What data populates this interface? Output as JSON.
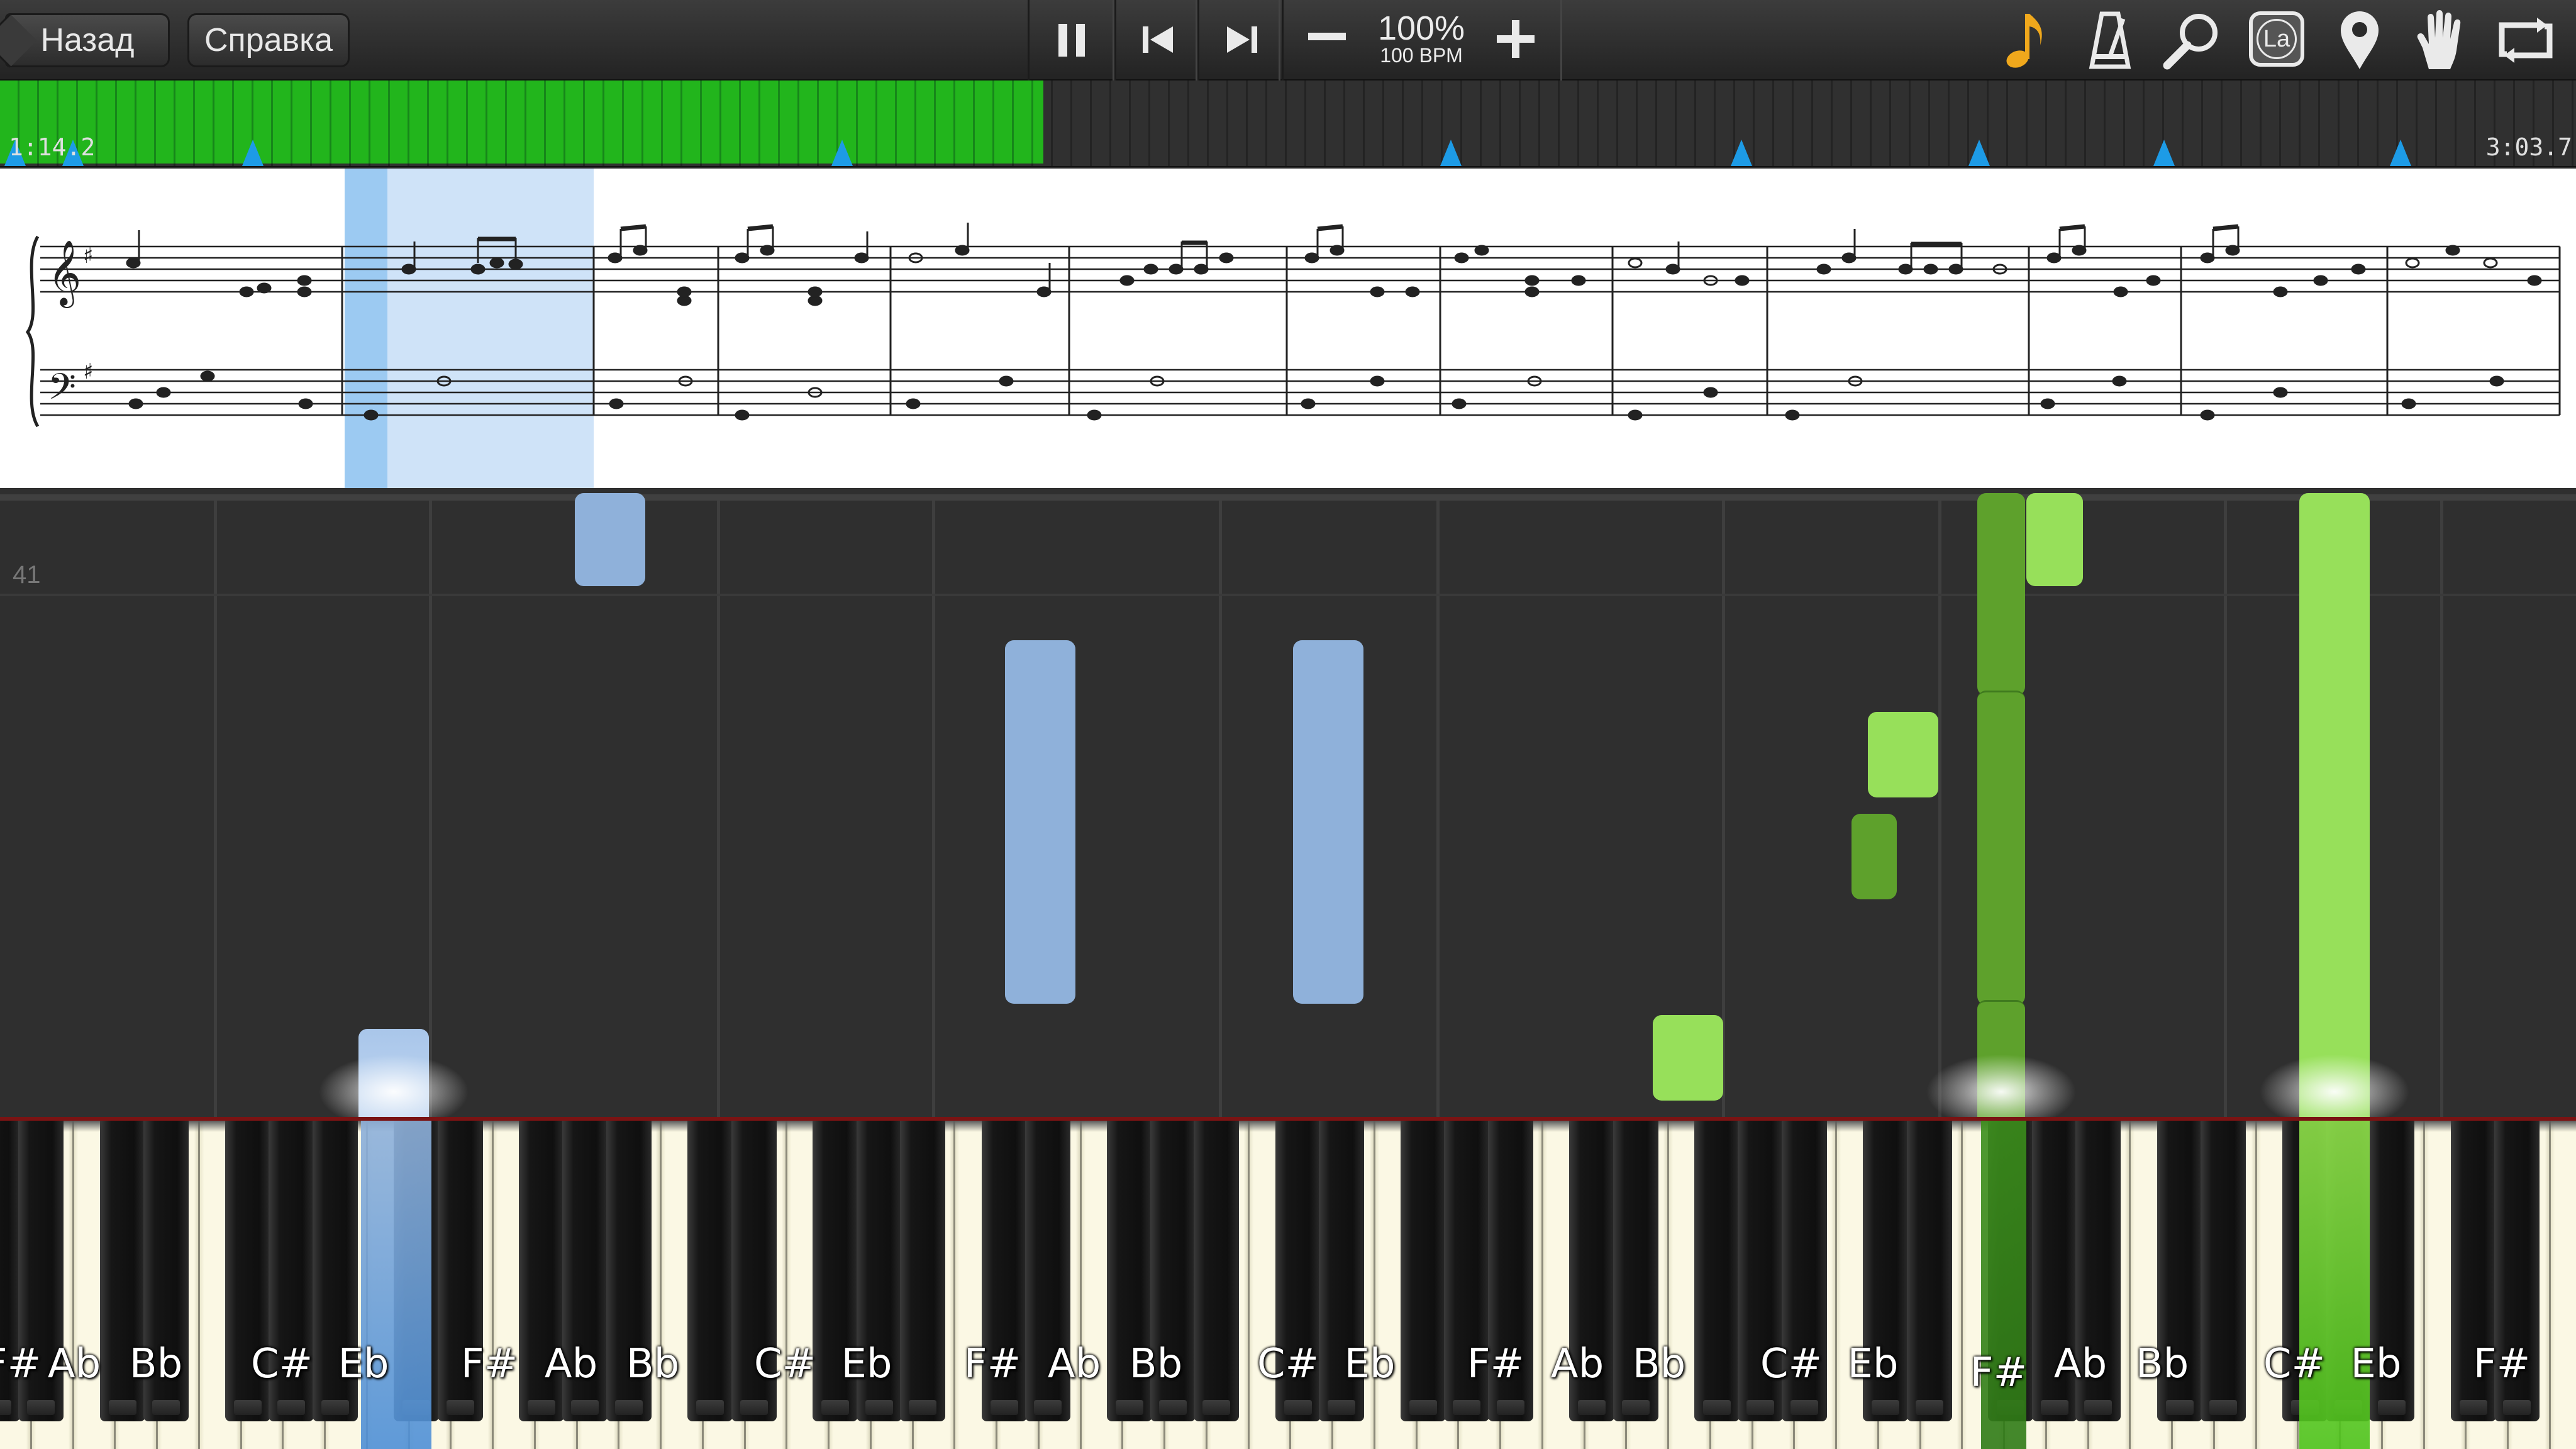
{
  "toolbar": {
    "back_label": "Назад",
    "help_label": "Справка",
    "tempo_percent": "100%",
    "tempo_bpm": "100 BPM",
    "icons": [
      "pause-icon",
      "skip-back-icon",
      "skip-forward-icon",
      "minus-icon",
      "plus-icon",
      "note-icon",
      "metronome-icon",
      "search-icon",
      "la-icon",
      "location-pin-icon",
      "hand-icon",
      "loop-icon"
    ],
    "la_label": "La",
    "accent_color": "#f0a81c"
  },
  "timeline": {
    "current_time": "1:14.2",
    "total_time": "3:03.7",
    "progress": 0.405,
    "bookmark_count": 9,
    "progress_color": "#22b51c",
    "marker_color": "#1d9be6"
  },
  "piano_roll": {
    "measure_number": "41",
    "left_hand_color": "#8fb1da",
    "right_hand_color": "#97e05a"
  },
  "keyboard": {
    "labels": [
      "F#",
      "Ab",
      "Bb",
      "C#",
      "Eb",
      "F#",
      "Ab",
      "Bb",
      "C#",
      "Eb",
      "F#",
      "Ab",
      "Bb",
      "C#",
      "Eb",
      "F#",
      "Ab",
      "Bb",
      "C#",
      "Eb",
      "F#",
      "Ab",
      "Bb",
      "C#",
      "Eb",
      "F#"
    ],
    "pressed": [
      "Eb",
      "F#",
      "Eb"
    ]
  }
}
